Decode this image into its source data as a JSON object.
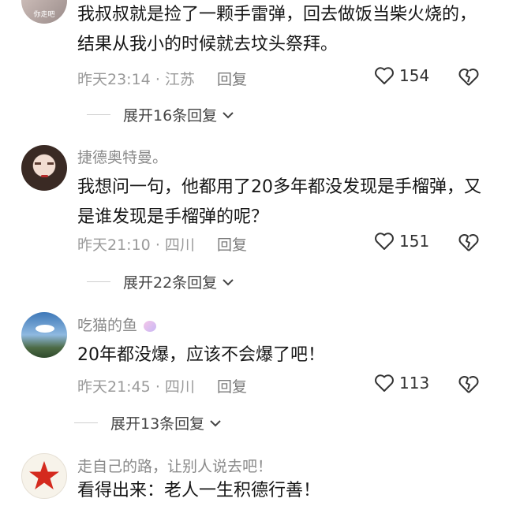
{
  "comments": [
    {
      "avatar_caption": "你走吧",
      "text": "我叔叔就是捡了一颗手雷弹，回去做饭当柴火烧的，结果从我小的时候就去坟头祭拜。",
      "time": "昨天23:14",
      "location": "江苏",
      "reply_label": "回复",
      "likes": "154",
      "expand_label": "展开16条回复"
    },
    {
      "username": "捷德奥特曼。",
      "text": "我想问一句，他都用了20多年都没发现是手榴弹，又是谁发现是手榴弹的呢？",
      "time": "昨天21:10",
      "location": "四川",
      "reply_label": "回复",
      "likes": "151",
      "expand_label": "展开22条回复"
    },
    {
      "username": "吃猫的鱼",
      "text": "20年都没爆，应该不会爆了吧！",
      "time": "昨天21:45",
      "location": "四川",
      "reply_label": "回复",
      "likes": "113",
      "expand_label": "展开13条回复"
    },
    {
      "username": "走自己的路，让别人说去吧！",
      "text": "看得出来：老人一生积德行善！"
    }
  ],
  "colors": {
    "meta": "#9a9a9a",
    "star_red": "#d42a1e"
  },
  "icons": [
    "heart-outline-icon",
    "broken-heart-icon",
    "chevron-down-icon",
    "unicorn-icon",
    "red-star-icon"
  ]
}
